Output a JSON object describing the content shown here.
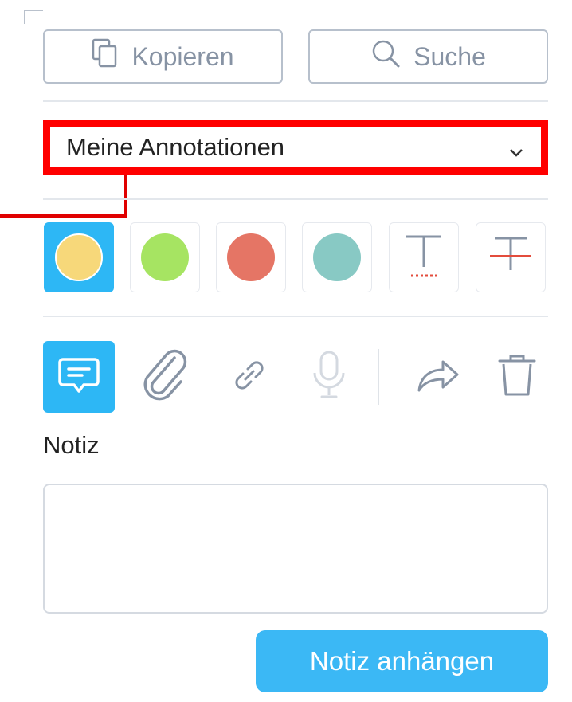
{
  "toolbar": {
    "copy_label": "Kopieren",
    "search_label": "Suche"
  },
  "annotations_select": {
    "selected": "Meine Annotationen"
  },
  "colors": {
    "yellow": "#f7d87a",
    "green": "#a6e462",
    "red": "#e57565",
    "teal": "#88c9c4",
    "accent": "#2db7f5",
    "highlight_box": "#ff0000"
  },
  "palette": [
    {
      "name": "yellow",
      "active": true
    },
    {
      "name": "green",
      "active": false
    },
    {
      "name": "red",
      "active": false
    },
    {
      "name": "teal",
      "active": false
    },
    {
      "name": "text-underline-icon",
      "active": false
    },
    {
      "name": "text-strikethrough-icon",
      "active": false
    }
  ],
  "tools": [
    "note-icon",
    "paperclip-icon",
    "link-icon",
    "microphone-icon",
    "share-icon",
    "trash-icon"
  ],
  "note": {
    "label": "Notiz",
    "value": "",
    "submit_label": "Notiz anhängen"
  }
}
